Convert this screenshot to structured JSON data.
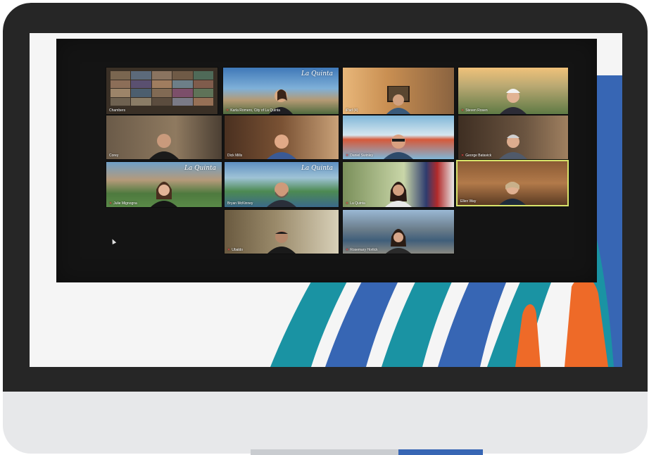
{
  "participants": [
    {
      "name": "Chambers"
    },
    {
      "name": "Karla Romero, City of La Quinta",
      "logo": "La Quinta"
    },
    {
      "name": "iPad (4)"
    },
    {
      "name": "Steven Rosen"
    },
    {
      "name": "Corey"
    },
    {
      "name": "Dick Mills"
    },
    {
      "name": "Daniel Swinley"
    },
    {
      "name": "George Batavick"
    },
    {
      "name": "Julie Mignogna",
      "logo": "La Quinta"
    },
    {
      "name": "Bryan McKinney",
      "logo": "La Quinta"
    },
    {
      "name": "La Quinta"
    },
    {
      "name": "Ellen Way"
    },
    {
      "name": "Ubaldo"
    },
    {
      "name": "Rosemary Horlick"
    }
  ],
  "colors": {
    "bezel": "#262626",
    "chassis": "#e7e8ea",
    "teal": "#1a93a3",
    "blue": "#3766b4",
    "orange": "#ee6a28",
    "active_speaker": "#d8e36a"
  },
  "icons": [
    "muted-mic-icon",
    "mouse-pointer-icon"
  ]
}
